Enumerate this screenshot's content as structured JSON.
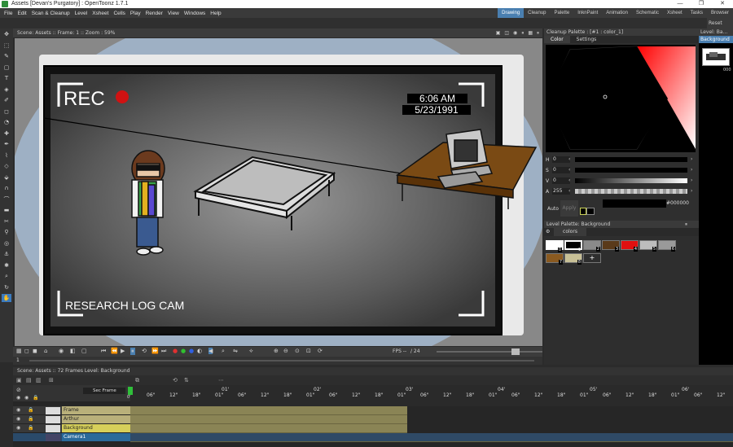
{
  "window": {
    "title": "Assets [Devan's Purgatory] : OpenToonz 1.7.1",
    "controls": [
      "—",
      "❐",
      "✕"
    ]
  },
  "menu": [
    "File",
    "Edit",
    "Scan & Cleanup",
    "Level",
    "Xsheet",
    "Cells",
    "Play",
    "Render",
    "View",
    "Windows",
    "Help"
  ],
  "rooms": [
    {
      "label": "Drawing",
      "active": true
    },
    {
      "label": "Cleanup",
      "active": false
    },
    {
      "label": "Palette",
      "active": false
    },
    {
      "label": "InknPaint",
      "active": false
    },
    {
      "label": "Animation",
      "active": false
    },
    {
      "label": "Schematic",
      "active": false
    },
    {
      "label": "Xsheet",
      "active": false
    },
    {
      "label": "Tasks",
      "active": false
    },
    {
      "label": "Browser",
      "active": false
    }
  ],
  "viewer": {
    "header": "Scene: Assets  ::  Frame: 1  ::  Zoom : 59%",
    "fps_label": "FPS --",
    "fps_value": "/ 24",
    "scene": {
      "rec_label": "REC",
      "time": "6:06 AM",
      "date": "5/23/1991",
      "caption": "RESEARCH LOG CAM"
    },
    "frame_field": "1"
  },
  "cleanup_palette": {
    "header": "Cleanup Palette : [#1 : color_1]",
    "tabs": [
      "Color",
      "Settings"
    ],
    "channels": [
      {
        "label": "H",
        "value": "0"
      },
      {
        "label": "S",
        "value": "0"
      },
      {
        "label": "V",
        "value": "0"
      },
      {
        "label": "A",
        "value": "255"
      }
    ],
    "auto_label": "Auto",
    "apply_label": "Apply",
    "hex": "#000000"
  },
  "level_palette": {
    "header": "Level Palette: Background",
    "page_tab": "colors",
    "chips": [
      {
        "index": "0",
        "color": "#ffffff"
      },
      {
        "index": "1",
        "color": "#000000"
      },
      {
        "index": "2",
        "color": "#8a8a8a"
      },
      {
        "index": "3",
        "color": "#5a3a1a"
      },
      {
        "index": "4",
        "color": "#e01010"
      },
      {
        "index": "5",
        "color": "#bdbdbd"
      },
      {
        "index": "6",
        "color": "#9a9a9a"
      },
      {
        "index": "7",
        "color": "#8a5a20"
      },
      {
        "index": "8",
        "color": "#c8c096"
      }
    ],
    "add_label": "+"
  },
  "level_strip": {
    "header": "Level: Ba...",
    "button": "Background",
    "reset": "Reset Position",
    "frame_label": "000"
  },
  "xsheet": {
    "header": "Scene: Assets  ::  72 Frames  Level: Background",
    "frame_mode": "Sec Frame",
    "layers": [
      {
        "name": "Frame"
      },
      {
        "name": "Arthur"
      },
      {
        "name": "Background"
      },
      {
        "name": "Camera1"
      }
    ],
    "ruler_top": [
      "01'",
      "02'",
      "03'",
      "04'",
      "05'",
      "06'"
    ],
    "ruler_bottom": [
      "06\"",
      "12\"",
      "18\"",
      "01\"",
      "06\"",
      "12\"",
      "18\"",
      "01\"",
      "06\"",
      "12\"",
      "18\"",
      "01\"",
      "06\"",
      "12\"",
      "18\"",
      "01\"",
      "06\"",
      "12\"",
      "18\"",
      "01\"",
      "06\"",
      "12\"",
      "18\"",
      "01\"",
      "06\"",
      "12\""
    ],
    "current_frame": "0'"
  },
  "colors": {
    "accent": "#4a7fb0",
    "cell": "#8a8455",
    "layer_label": "#b9b07a"
  }
}
